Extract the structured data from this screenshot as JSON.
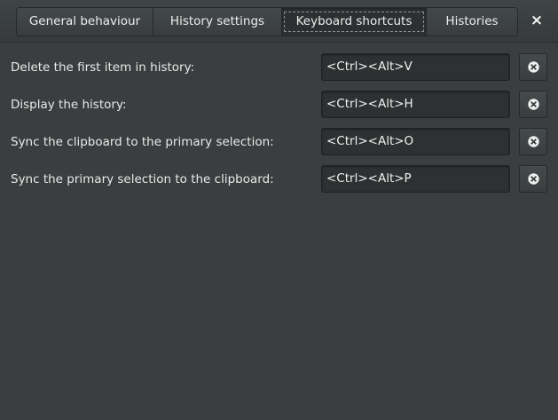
{
  "tabs": [
    {
      "label": "General behaviour",
      "active": false
    },
    {
      "label": "History settings",
      "active": false
    },
    {
      "label": "Keyboard shortcuts",
      "active": true
    },
    {
      "label": "Histories",
      "active": false
    }
  ],
  "close_icon": "×",
  "shortcuts": [
    {
      "label": "Delete the first item in history:",
      "value": "<Ctrl><Alt>V"
    },
    {
      "label": "Display the history:",
      "value": "<Ctrl><Alt>H"
    },
    {
      "label": "Sync the clipboard to the primary selection:",
      "value": "<Ctrl><Alt>O"
    },
    {
      "label": "Sync the primary selection to the clipboard:",
      "value": "<Ctrl><Alt>P"
    }
  ],
  "icons": {
    "clear": "clear-circle-x-icon",
    "close": "close-icon"
  },
  "colors": {
    "background": "#3a3e3f",
    "field": "#2d3132",
    "text": "#e8eae9"
  }
}
